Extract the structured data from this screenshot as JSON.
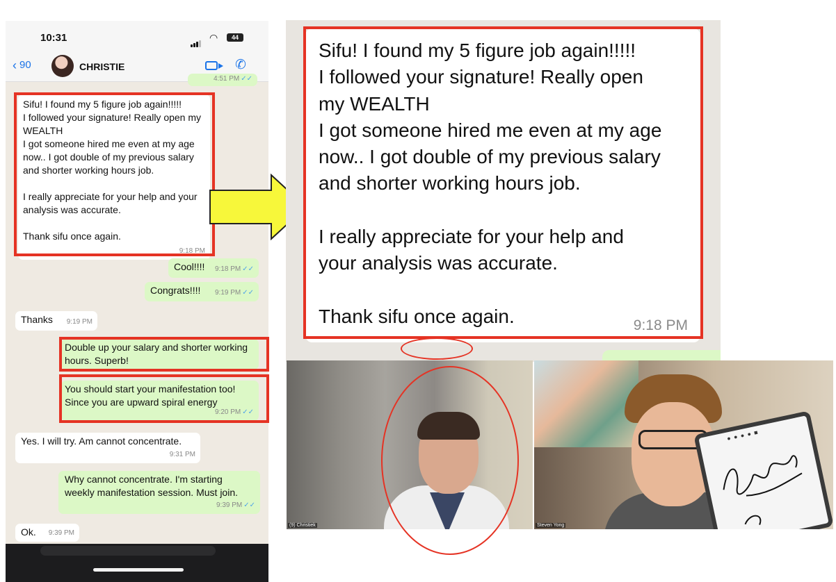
{
  "phone": {
    "status_time": "10:31",
    "battery": "44",
    "back_count": "90",
    "contact_name": "CHRISTIE",
    "top_partial_time": "4:51 PM"
  },
  "messages": [
    {
      "dir": "in",
      "text": "Sifu! I found my 5 figure job again!!!!!\nI followed your signature! Really open my WEALTH\nI got someone hired me even at my age now.. I got double of my previous salary and shorter working hours job.\n\n I really appreciate for your help and your analysis was accurate.\n\nThank sifu once again.",
      "time": "9:18 PM"
    },
    {
      "dir": "out",
      "text": "Cool!!!!",
      "time": "9:18 PM"
    },
    {
      "dir": "out",
      "text": "Congrats!!!!",
      "time": "9:19 PM"
    },
    {
      "dir": "in",
      "text": "Thanks",
      "time": "9:19 PM"
    },
    {
      "dir": "out",
      "text": "Double up your salary and shorter working hours. Superb!",
      "time": ""
    },
    {
      "dir": "out",
      "text": "You should start your manifestation too! Since you are upward spiral energy",
      "time": "9:20 PM"
    },
    {
      "dir": "in",
      "text": "Yes. I will try. Am cannot concentrate.",
      "time": "9:31 PM"
    },
    {
      "dir": "out",
      "text": "Why cannot concentrate. I'm starting weekly manifestation session. Must join.",
      "time": "9:39 PM"
    },
    {
      "dir": "in",
      "text": "Ok.",
      "time": "9:39 PM"
    }
  ],
  "zoom": {
    "text": "Sifu! I found my 5 figure job again!!!!!\nI followed your signature! Really open\nmy WEALTH\nI got someone hired me even at my age\nnow.. I got double of my previous salary\nand shorter working hours job.\n\n I really appreciate for your help and\nyour analysis was accurate.\n\nThank sifu once again.",
    "time": "9:18 PM"
  },
  "video": {
    "left_name": "(9) Christiek",
    "right_name": "Steven Yong"
  },
  "colors": {
    "annotation_red": "#e53324",
    "arrow_yellow": "#f7f73a",
    "bubble_out": "#dcf8c6",
    "chat_bg": "#efeae2",
    "ios_blue": "#1a73e8"
  }
}
